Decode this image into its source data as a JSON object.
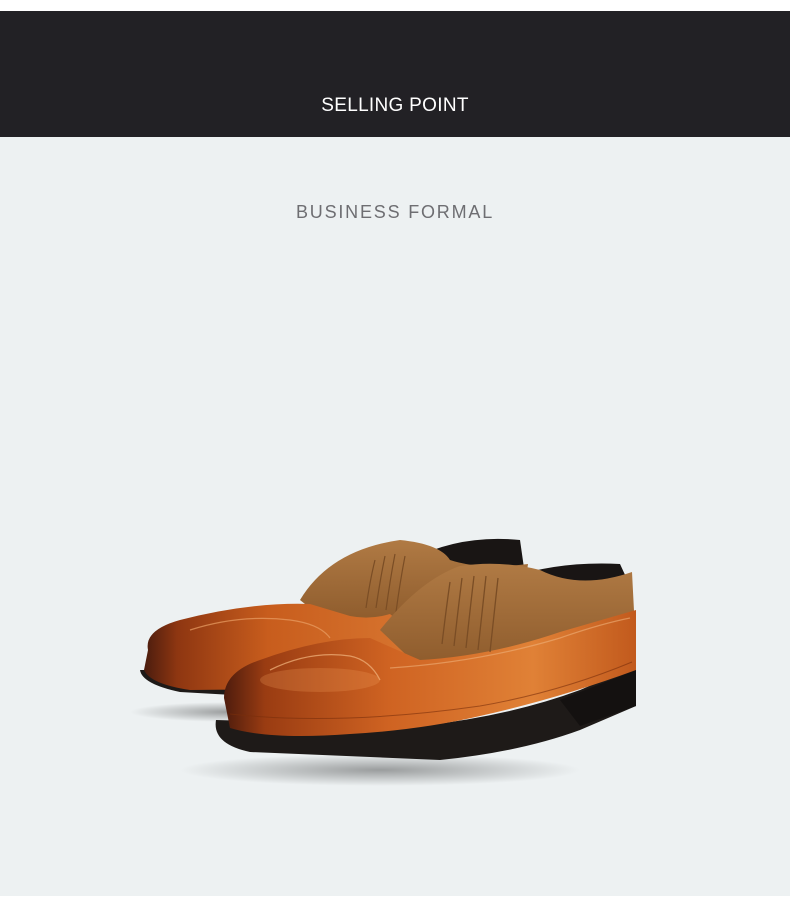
{
  "header": {
    "title": "SELLING POINT",
    "background_color": "#222125",
    "text_color": "#ffffff"
  },
  "section": {
    "title": "BUSINESS FORMAL",
    "background_color": "#edf1f2",
    "text_color": "#6e6e72"
  },
  "product": {
    "image_icon": "brown-leather-slip-on-shoes-icon",
    "leather_color": "#c2561a",
    "suede_color": "#a8733d",
    "sole_color": "#1e1a18"
  }
}
